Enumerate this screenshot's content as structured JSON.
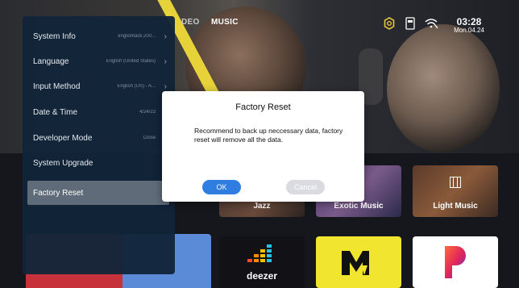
{
  "topbar": {
    "categories": [
      {
        "label": "DEO"
      },
      {
        "label": "MUSIC"
      }
    ],
    "clock": {
      "time": "03:28",
      "date": "Mon.04.24"
    }
  },
  "settings": {
    "items": [
      {
        "label": "System Info",
        "value": "englishtack.200...",
        "chevron": "›"
      },
      {
        "label": "Language",
        "value": "English (United States)",
        "chevron": "›"
      },
      {
        "label": "Input Method",
        "value": "English (US) - A...",
        "chevron": "›"
      },
      {
        "label": "Date & Time",
        "value": "4/24/23",
        "chevron": ""
      },
      {
        "label": "Developer Mode",
        "value": "Close",
        "chevron": ""
      },
      {
        "label": "System Upgrade",
        "value": "",
        "chevron": ""
      },
      {
        "label": "Factory Reset",
        "value": "",
        "chevron": ""
      }
    ],
    "selected_index": 6
  },
  "dialog": {
    "title": "Factory Reset",
    "message": "Recommend to back up neccessary data, factory reset will remove all the data.",
    "ok_label": "OK",
    "cancel_label": "Cancel"
  },
  "tiles": [
    {
      "label": "Jazz"
    },
    {
      "label": "Exotic Music"
    },
    {
      "label": "Light Music"
    },
    {
      "label": "deezer"
    }
  ],
  "colors": {
    "panel_bg": "#122438",
    "selected_row": "#5f6b78",
    "ok_button": "#2f7de0",
    "cancel_button": "#d9dbe0",
    "accent_yellow": "#e7d23a"
  }
}
